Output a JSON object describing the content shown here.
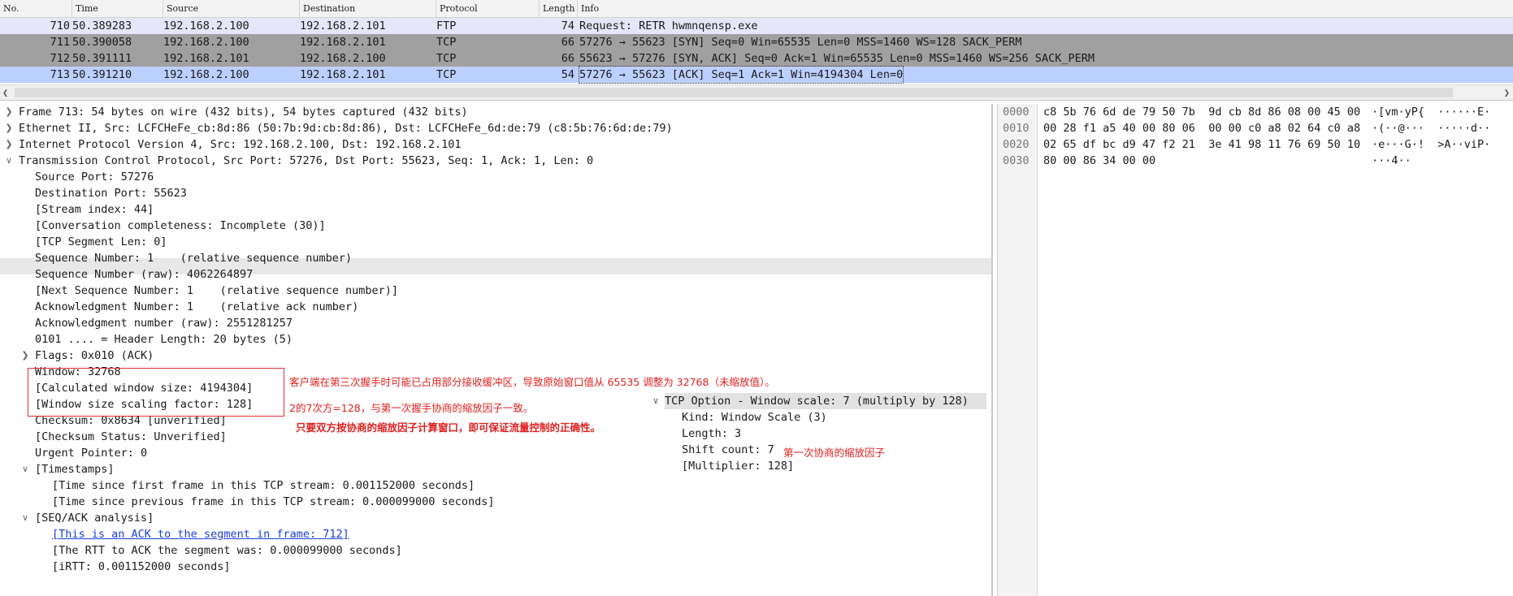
{
  "packet_list": {
    "columns": [
      "No.",
      "Time",
      "Source",
      "Destination",
      "Protocol",
      "Length",
      "Info"
    ],
    "rows": [
      {
        "no": "710",
        "time": "50.389283",
        "source": "192.168.2.100",
        "destination": "192.168.2.101",
        "protocol": "FTP",
        "length": "74",
        "info": "Request: RETR hwmnqensp.exe",
        "bg": "#e6e6fa"
      },
      {
        "no": "711",
        "time": "50.390058",
        "source": "192.168.2.100",
        "destination": "192.168.2.101",
        "protocol": "TCP",
        "length": "66",
        "info": "57276 → 55623 [SYN] Seq=0 Win=65535 Len=0 MSS=1460 WS=128 SACK_PERM",
        "bg": "#a0a0a0"
      },
      {
        "no": "712",
        "time": "50.391111",
        "source": "192.168.2.101",
        "destination": "192.168.2.100",
        "protocol": "TCP",
        "length": "66",
        "info": "55623 → 57276 [SYN, ACK] Seq=0 Ack=1 Win=65535 Len=0 MSS=1460 WS=256 SACK_PERM",
        "bg": "#a0a0a0"
      },
      {
        "no": "713",
        "time": "50.391210",
        "source": "192.168.2.100",
        "destination": "192.168.2.101",
        "protocol": "TCP",
        "length": "54",
        "info": "57276 → 55623 [ACK] Seq=1 Ack=1 Win=4194304 Len=0",
        "bg": "#bcd0ff"
      }
    ],
    "scroll_left_icon": "chevron-left-icon",
    "scroll_right_icon": "chevron-right-icon"
  },
  "details": {
    "frame": "Frame 713: 54 bytes on wire (432 bits), 54 bytes captured (432 bits)",
    "ethernet": "Ethernet II, Src: LCFCHeFe_cb:8d:86 (50:7b:9d:cb:8d:86), Dst: LCFCHeFe_6d:de:79 (c8:5b:76:6d:de:79)",
    "ip": "Internet Protocol Version 4, Src: 192.168.2.100, Dst: 192.168.2.101",
    "tcp": "Transmission Control Protocol, Src Port: 57276, Dst Port: 55623, Seq: 1, Ack: 1, Len: 0",
    "tcp_fields": [
      "Source Port: 57276",
      "Destination Port: 55623",
      "[Stream index: 44]",
      "[Conversation completeness: Incomplete (30)]",
      "[TCP Segment Len: 0]",
      "Sequence Number: 1    (relative sequence number)",
      "Sequence Number (raw): 4062264897",
      "[Next Sequence Number: 1    (relative sequence number)]",
      "Acknowledgment Number: 1    (relative ack number)",
      "Acknowledgment number (raw): 2551281257",
      "0101 .... = Header Length: 20 bytes (5)"
    ],
    "flags": "Flags: 0x010 (ACK)",
    "window": "Window: 32768",
    "calc_window": "[Calculated window size: 4194304]",
    "scaling_factor": "[Window size scaling factor: 128]",
    "checksum": "Checksum: 0x8634 [unverified]",
    "checksum_status": "[Checksum Status: Unverified]",
    "urgent": "Urgent Pointer: 0",
    "timestamps": "[Timestamps]",
    "ts_first": "[Time since first frame in this TCP stream: 0.001152000 seconds]",
    "ts_prev": "[Time since previous frame in this TCP stream: 0.000099000 seconds]",
    "seq_ack": "[SEQ/ACK analysis]",
    "ack_link": "[This is an ACK to the segment in frame: 712]",
    "rtt": "[The RTT to ACK the segment was: 0.000099000 seconds]",
    "irtt": "[iRTT: 0.001152000 seconds]",
    "annotations": {
      "note1": "客户端在第三次握手时可能已占用部分接收缓冲区，导致原始窗口值从 65535 调整为 32768（未缩放值）。",
      "note2": "2的7次方=128，与第一次握手协商的缩放因子一致。",
      "note3": "只要双方按协商的缩放因子计算窗口，即可保证流量控制的正确性。",
      "note4": "第一次协商的缩放因子"
    },
    "option": {
      "title": "TCP Option - Window scale: 7 (multiply by 128)",
      "kind": "Kind: Window Scale (3)",
      "length": "Length: 3",
      "shift": "Shift count: 7",
      "multiplier": "[Multiplier: 128]"
    }
  },
  "hex": {
    "rows": [
      {
        "offset": "0000",
        "bytes": "c8 5b 76 6d de 79 50 7b  9d cb 8d 86 08 00 45 00",
        "ascii": "·[vm·yP{  ······E·"
      },
      {
        "offset": "0010",
        "bytes": "00 28 f1 a5 40 00 80 06  00 00 c0 a8 02 64 c0 a8",
        "ascii": "·(··@···  ·····d··"
      },
      {
        "offset": "0020",
        "bytes": "02 65 df bc d9 47 f2 21  3e 41 98 11 76 69 50 10",
        "ascii": "·e···G·!  >A··viP·"
      },
      {
        "offset": "0030",
        "bytes": "80 00 86 34 00 00",
        "ascii": "···4··"
      }
    ]
  },
  "colors": {
    "annotation_red": "#e02020",
    "selected_row": "#bcd0ff",
    "tcp_handshake_row": "#a0a0a0",
    "ftp_row": "#e6e6fa",
    "link_blue": "#1a3ddb"
  }
}
